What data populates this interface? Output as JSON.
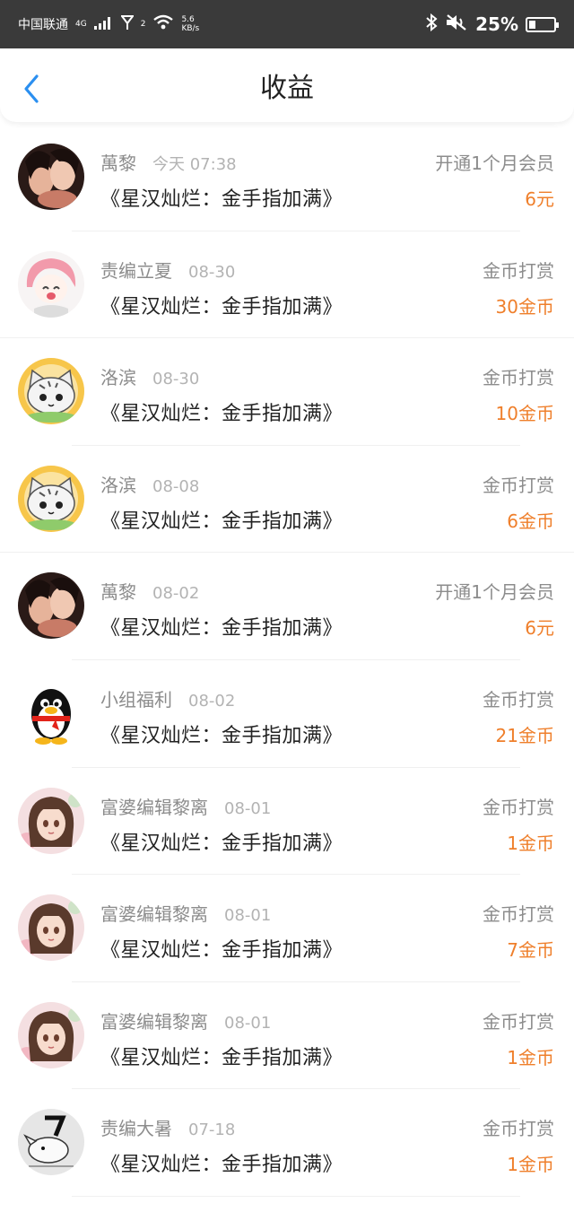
{
  "status_bar": {
    "carrier": "中国联通",
    "network": "4G",
    "sim2": "2",
    "speed_value": "5.6",
    "speed_unit": "KB/s",
    "battery_percent": "25%",
    "battery_level": 0.25
  },
  "header": {
    "title": "收益",
    "back_icon": "chevron-left-icon",
    "accent_color": "#2b8ff0"
  },
  "accent_amount_color": "#ef7f2b",
  "items": [
    {
      "name": "萬黎",
      "time": "今天 07:38",
      "book": "《星汉灿烂：金手指加满》",
      "type": "开通1个月会员",
      "amount": "6元",
      "avatar": "photo-avatar"
    },
    {
      "name": "责编立夏",
      "time": "08-30",
      "book": "《星汉灿烂：金手指加满》",
      "type": "金币打赏",
      "amount": "30金币",
      "avatar": "anime-girl-avatar"
    },
    {
      "name": "洛滨",
      "time": "08-30",
      "book": "《星汉灿烂：金手指加满》",
      "type": "金币打赏",
      "amount": "10金币",
      "avatar": "cat-avatar"
    },
    {
      "name": "洛滨",
      "time": "08-08",
      "book": "《星汉灿烂：金手指加满》",
      "type": "金币打赏",
      "amount": "6金币",
      "avatar": "cat-avatar"
    },
    {
      "name": "萬黎",
      "time": "08-02",
      "book": "《星汉灿烂：金手指加满》",
      "type": "开通1个月会员",
      "amount": "6元",
      "avatar": "photo-avatar"
    },
    {
      "name": "小组福利",
      "time": "08-02",
      "book": "《星汉灿烂：金手指加满》",
      "type": "金币打赏",
      "amount": "21金币",
      "avatar": "penguin-avatar"
    },
    {
      "name": "富婆编辑黎离",
      "time": "08-01",
      "book": "《星汉灿烂：金手指加满》",
      "type": "金币打赏",
      "amount": "1金币",
      "avatar": "painted-girl-avatar"
    },
    {
      "name": "富婆编辑黎离",
      "time": "08-01",
      "book": "《星汉灿烂：金手指加满》",
      "type": "金币打赏",
      "amount": "7金币",
      "avatar": "painted-girl-avatar"
    },
    {
      "name": "富婆编辑黎离",
      "time": "08-01",
      "book": "《星汉灿烂：金手指加满》",
      "type": "金币打赏",
      "amount": "1金币",
      "avatar": "painted-girl-avatar"
    },
    {
      "name": "责编大暑",
      "time": "07-18",
      "book": "《星汉灿烂：金手指加满》",
      "type": "金币打赏",
      "amount": "1金币",
      "avatar": "sketch-avatar"
    }
  ]
}
